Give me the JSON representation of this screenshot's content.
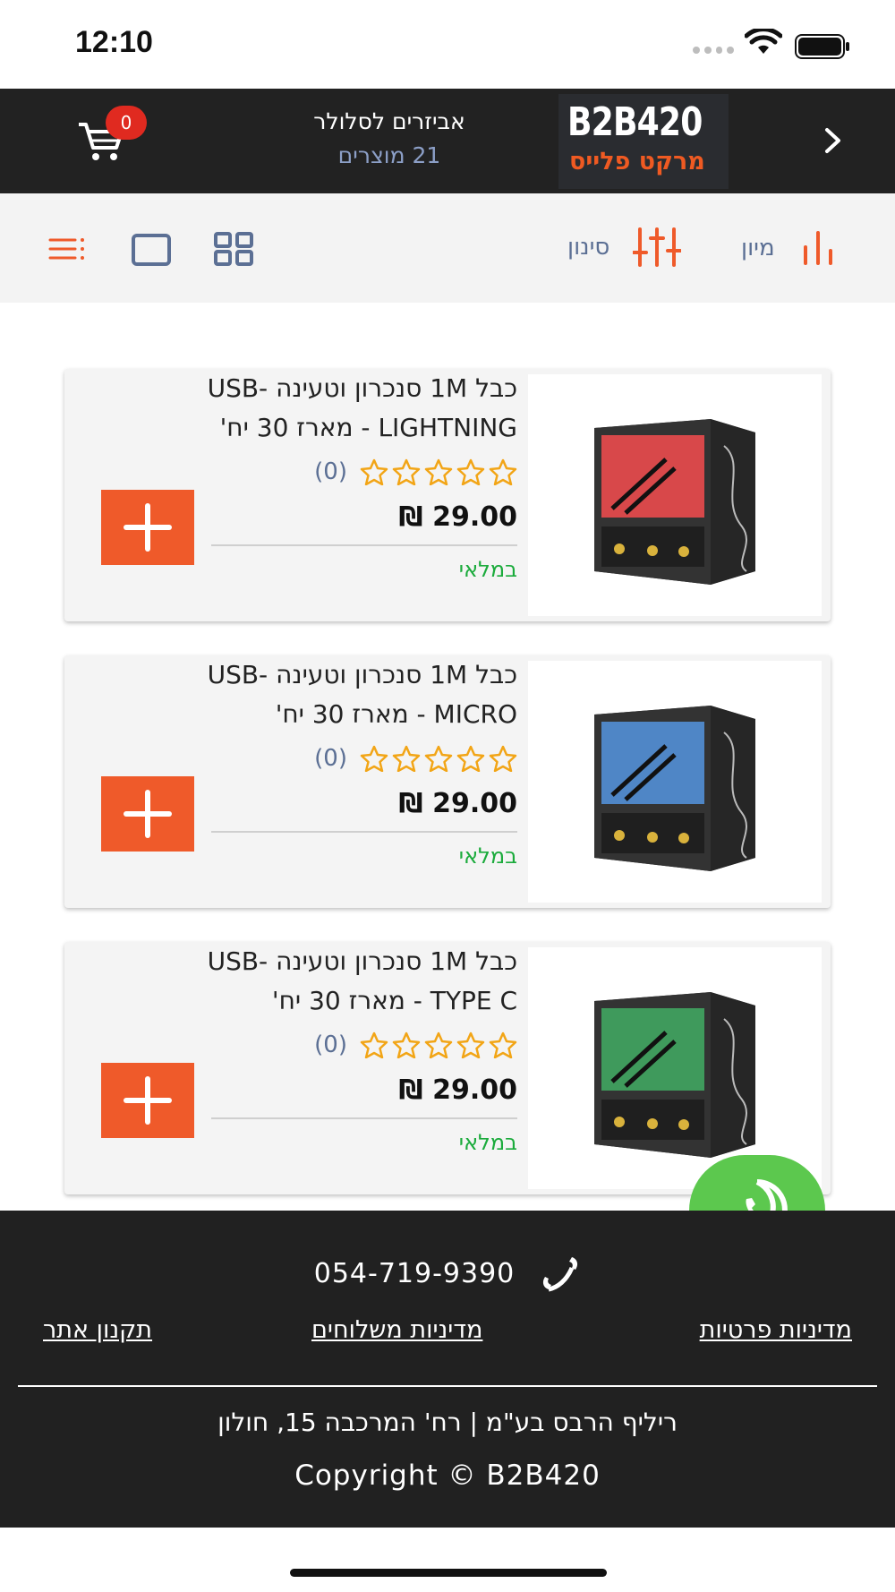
{
  "status_bar": {
    "time": "12:10"
  },
  "header": {
    "title": "אביזרים לסלולר",
    "subtitle": "21 מוצרים",
    "logo_top": "B2B420",
    "logo_bottom": "מרקט פלייס",
    "cart_count": "0"
  },
  "toolbar": {
    "sort_label": "מיון",
    "filter_label": "סינון"
  },
  "products": [
    {
      "name": "כבל 1M סנכרון וטעינה USB- LIGHTNING - מארז 30 יח'",
      "rating_count": "(0)",
      "price": "29.00 ₪",
      "stock": "במלאי",
      "image_label": "USB - LIGHTNING",
      "image_color": "#d8484a"
    },
    {
      "name": "כבל 1M סנכרון וטעינה USB- MICRO - מארז 30 יח'",
      "rating_count": "(0)",
      "price": "29.00 ₪",
      "stock": "במלאי",
      "image_label": "USB - MICRO",
      "image_color": "#4f86c6"
    },
    {
      "name": "כבל 1M סנכרון וטעינה USB- TYPE C - מארז 30 יח'",
      "rating_count": "(0)",
      "price": "29.00 ₪",
      "stock": "במלאי",
      "image_label": "USB - TYPE C",
      "image_color": "#3f9a5c"
    }
  ],
  "footer": {
    "phone": "054-719-9390",
    "links": [
      "מדיניות פרטיות",
      "מדיניות משלוחים",
      "תקנון אתר"
    ],
    "address": "ריליף הרבס בע\"מ | רח' המרכבה 15, חולון",
    "copyright": "Copyright © B2B420"
  },
  "colors": {
    "accent": "#ef5a2a",
    "header_bg": "#222222",
    "stock_green": "#1bab3c",
    "whatsapp": "#5cc84e"
  }
}
